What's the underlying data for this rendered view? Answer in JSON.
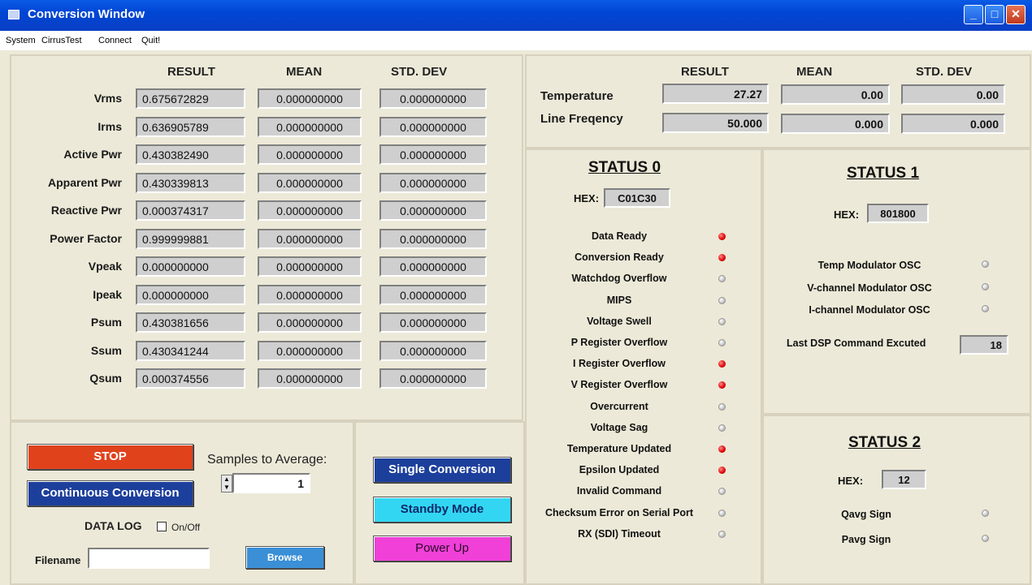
{
  "window": {
    "title": "Conversion Window"
  },
  "menu": [
    "System",
    "CirrusTest",
    "Connect",
    "Quit!"
  ],
  "main": {
    "headers": [
      "RESULT",
      "MEAN",
      "STD. DEV"
    ],
    "rows": [
      {
        "label": "Vrms",
        "result": "0.675672829",
        "mean": "0.000000000",
        "std": "0.000000000"
      },
      {
        "label": "Irms",
        "result": "0.636905789",
        "mean": "0.000000000",
        "std": "0.000000000"
      },
      {
        "label": "Active Pwr",
        "result": "0.430382490",
        "mean": "0.000000000",
        "std": "0.000000000"
      },
      {
        "label": "Apparent Pwr",
        "result": "0.430339813",
        "mean": "0.000000000",
        "std": "0.000000000"
      },
      {
        "label": "Reactive Pwr",
        "result": "0.000374317",
        "mean": "0.000000000",
        "std": "0.000000000"
      },
      {
        "label": "Power Factor",
        "result": "0.999999881",
        "mean": "0.000000000",
        "std": "0.000000000"
      },
      {
        "label": "Vpeak",
        "result": "0.000000000",
        "mean": "0.000000000",
        "std": "0.000000000"
      },
      {
        "label": "Ipeak",
        "result": "0.000000000",
        "mean": "0.000000000",
        "std": "0.000000000"
      },
      {
        "label": "Psum",
        "result": "0.430381656",
        "mean": "0.000000000",
        "std": "0.000000000"
      },
      {
        "label": "Ssum",
        "result": "0.430341244",
        "mean": "0.000000000",
        "std": "0.000000000"
      },
      {
        "label": "Qsum",
        "result": "0.000374556",
        "mean": "0.000000000",
        "std": "0.000000000"
      }
    ]
  },
  "temp_panel": {
    "headers": [
      "RESULT",
      "MEAN",
      "STD. DEV"
    ],
    "rows": [
      {
        "label": "Temperature",
        "result": "27.27",
        "mean": "0.00",
        "std": "0.00"
      },
      {
        "label": "Line Freqency",
        "result": "50.000",
        "mean": "0.000",
        "std": "0.000"
      }
    ]
  },
  "status0": {
    "title": "STATUS 0",
    "hex_label": "HEX:",
    "hex": "C01C30",
    "items": [
      {
        "label": "Data Ready",
        "on": true
      },
      {
        "label": "Conversion Ready",
        "on": true
      },
      {
        "label": "Watchdog Overflow",
        "on": false
      },
      {
        "label": "MIPS",
        "on": false
      },
      {
        "label": "Voltage Swell",
        "on": false
      },
      {
        "label": "P Register Overflow",
        "on": false
      },
      {
        "label": "I Register Overflow",
        "on": true
      },
      {
        "label": "V Register Overflow",
        "on": true
      },
      {
        "label": "Overcurrent",
        "on": false
      },
      {
        "label": "Voltage Sag",
        "on": false
      },
      {
        "label": "Temperature Updated",
        "on": true
      },
      {
        "label": "Epsilon Updated",
        "on": true
      },
      {
        "label": "Invalid Command",
        "on": false
      },
      {
        "label": "Checksum Error on Serial Port",
        "on": false
      },
      {
        "label": "RX (SDI) Timeout",
        "on": false
      }
    ]
  },
  "status1": {
    "title": "STATUS 1",
    "hex_label": "HEX:",
    "hex": "801800",
    "items": [
      {
        "label": "Temp Modulator OSC",
        "on": false
      },
      {
        "label": "V-channel Modulator OSC",
        "on": false
      },
      {
        "label": "I-channel Modulator OSC",
        "on": false
      }
    ],
    "last_dsp_label": "Last DSP Command Excuted",
    "last_dsp_value": "18"
  },
  "status2": {
    "title": "STATUS 2",
    "hex_label": "HEX:",
    "hex": "12",
    "items": [
      {
        "label": "Qavg Sign",
        "on": false
      },
      {
        "label": "Pavg Sign",
        "on": false
      }
    ]
  },
  "controls": {
    "stop_label": "STOP",
    "continuous_label": "Continuous Conversion",
    "samples_label": "Samples to Average:",
    "samples_value": "1",
    "datalog_label": "DATA LOG",
    "onoff_label": "On/Off",
    "filename_label": "Filename",
    "filename_value": "",
    "browse_label": "Browse",
    "single_label": "Single Conversion",
    "standby_label": "Standby Mode",
    "powerup_label": "Power Up"
  },
  "colors": {
    "stop": "#e0421c",
    "continuous": "#1d3f9c",
    "single": "#1d3f9c",
    "standby": "#33d6f2",
    "powerup": "#f040d8",
    "browse": "#3a8fd6",
    "led_on": "#e00000",
    "led_off": "#cfcfcf"
  }
}
